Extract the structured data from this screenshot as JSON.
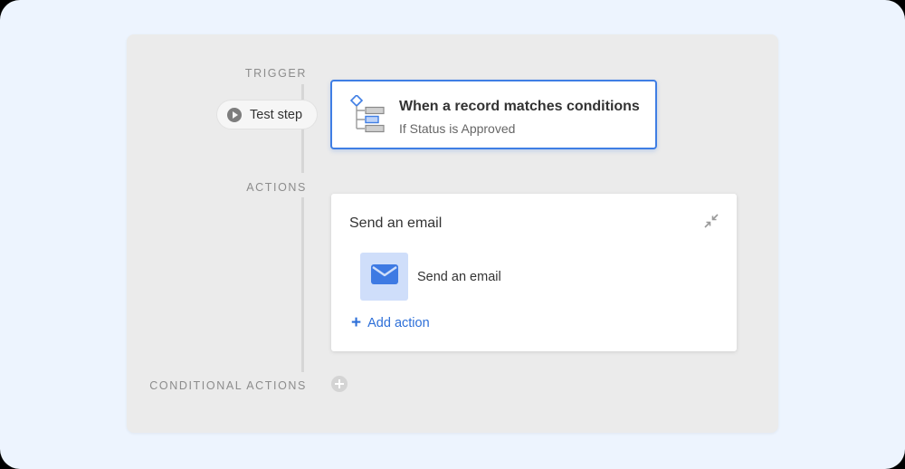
{
  "sections": {
    "trigger_label": "TRIGGER",
    "actions_label": "ACTIONS",
    "conditional_label": "CONDITIONAL ACTIONS"
  },
  "test_step": {
    "label": "Test step",
    "icon": "play-circle-icon"
  },
  "trigger": {
    "title": "When a record matches conditions",
    "subtitle": "If Status is Approved",
    "icon": "conditions-tree-icon"
  },
  "action_group": {
    "title": "Send an email",
    "collapse_icon": "collapse-arrows-icon",
    "items": [
      {
        "label": "Send an email",
        "icon": "envelope-icon"
      }
    ],
    "add_action_label": "Add action"
  },
  "colors": {
    "accent": "#3f7ee4",
    "link": "#2d6fd8",
    "panel_bg": "#ebebeb",
    "outer_bg": "#edf4fe",
    "email_tile_bg": "#cfdefa"
  }
}
